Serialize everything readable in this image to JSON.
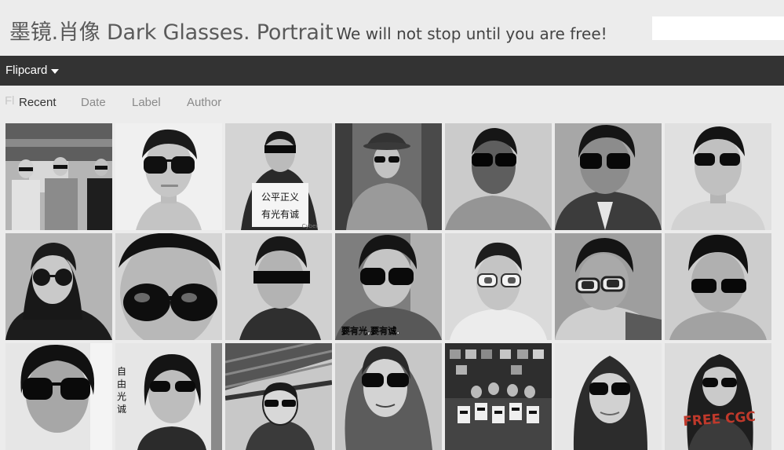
{
  "header": {
    "title": "墨镜.肖像 Dark Glasses. Portrait",
    "tagline": "We will not stop until you are free!",
    "search_placeholder": ""
  },
  "navbar": {
    "dropdown_label": "Flipcard"
  },
  "tabs": [
    {
      "label": "Recent",
      "active": true
    },
    {
      "label": "Date",
      "active": false
    },
    {
      "label": "Label",
      "active": false
    },
    {
      "label": "Author",
      "active": false
    }
  ],
  "ghost_label": "Fl",
  "photos": [
    {
      "subject": "group-of-men-sunglasses"
    },
    {
      "subject": "young-man-sunglasses"
    },
    {
      "subject": "woman-blindfold-holding-sign",
      "sign_line1": "公平正义",
      "sign_line2": "有光有诚",
      "watermark": "Cyber"
    },
    {
      "subject": "man-hat-sunglasses-coat"
    },
    {
      "subject": "man-sunglasses"
    },
    {
      "subject": "man-sunglasses-jacket"
    },
    {
      "subject": "young-man-sunglasses"
    },
    {
      "subject": "man-round-sunglasses-hood"
    },
    {
      "subject": "man-closeup-big-sunglasses"
    },
    {
      "subject": "man-blindfold"
    },
    {
      "subject": "man-sunglasses-caption",
      "caption": "要有光,要有诚."
    },
    {
      "subject": "man-white-sunglasses"
    },
    {
      "subject": "man-sunglasses-plaid-shirt"
    },
    {
      "subject": "man-sunglasses-smiling"
    },
    {
      "subject": "man-sunglasses-partial"
    },
    {
      "subject": "woman-sunglasses-vertical-text",
      "vertical_text": "自由光诚"
    },
    {
      "subject": "drawing-portrait-sunglasses"
    },
    {
      "subject": "woman-sunglasses-long-hair"
    },
    {
      "subject": "group-holding-portraits"
    },
    {
      "subject": "woman-sunglasses-smiling"
    },
    {
      "subject": "woman-sunglasses-free-cgc",
      "overlay_text": "FREE CGC"
    }
  ],
  "colors": {
    "page_bg": "#ececec",
    "navbar_bg": "#333333",
    "tab_inactive": "#8a8a8a",
    "overlay_red": "#c0392b"
  }
}
